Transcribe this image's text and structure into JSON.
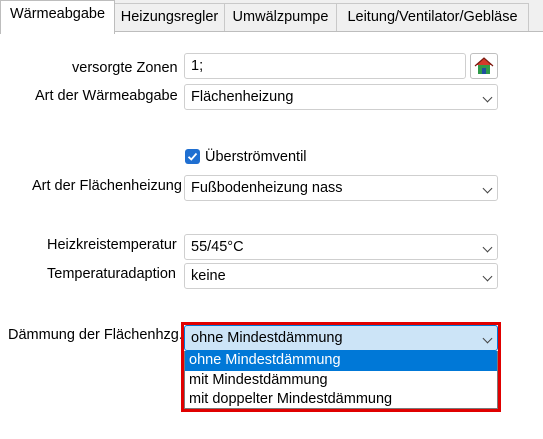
{
  "tabs": [
    {
      "label": "Wärmeabgabe",
      "active": true
    },
    {
      "label": "Heizungsregler",
      "active": false
    },
    {
      "label": "Umwälzpumpe",
      "active": false
    },
    {
      "label": "Leitung/Ventilator/Gebläse",
      "active": false
    }
  ],
  "form": {
    "versorgte_zonen": {
      "label": "versorgte Zonen",
      "value": "1;",
      "button_icon": "house-icon"
    },
    "art_waermeabgabe": {
      "label": "Art der Wärmeabgabe",
      "value": "Flächenheizung"
    },
    "ueberstroemventil": {
      "label": "Überströmventil",
      "checked": true
    },
    "art_flaechenheizung": {
      "label": "Art der Flächenheizung",
      "value": "Fußbodenheizung nass"
    },
    "heizkreistemperatur": {
      "label": "Heizkreistemperatur",
      "value": "55/45°C"
    },
    "temperaturadaption": {
      "label": "Temperaturadaption",
      "value": "keine"
    },
    "daemmung": {
      "label": "Dämmung der Flächenhzg.",
      "value": "ohne Mindestdämmung",
      "options": [
        "ohne Mindestdämmung",
        "mit Mindestdämmung",
        "mit doppelter Mindestdämmung"
      ],
      "selected_index": 0
    }
  },
  "colors": {
    "highlight": "#0078d7",
    "annotation_frame": "#e00000",
    "checkbox": "#1f6fd1"
  }
}
